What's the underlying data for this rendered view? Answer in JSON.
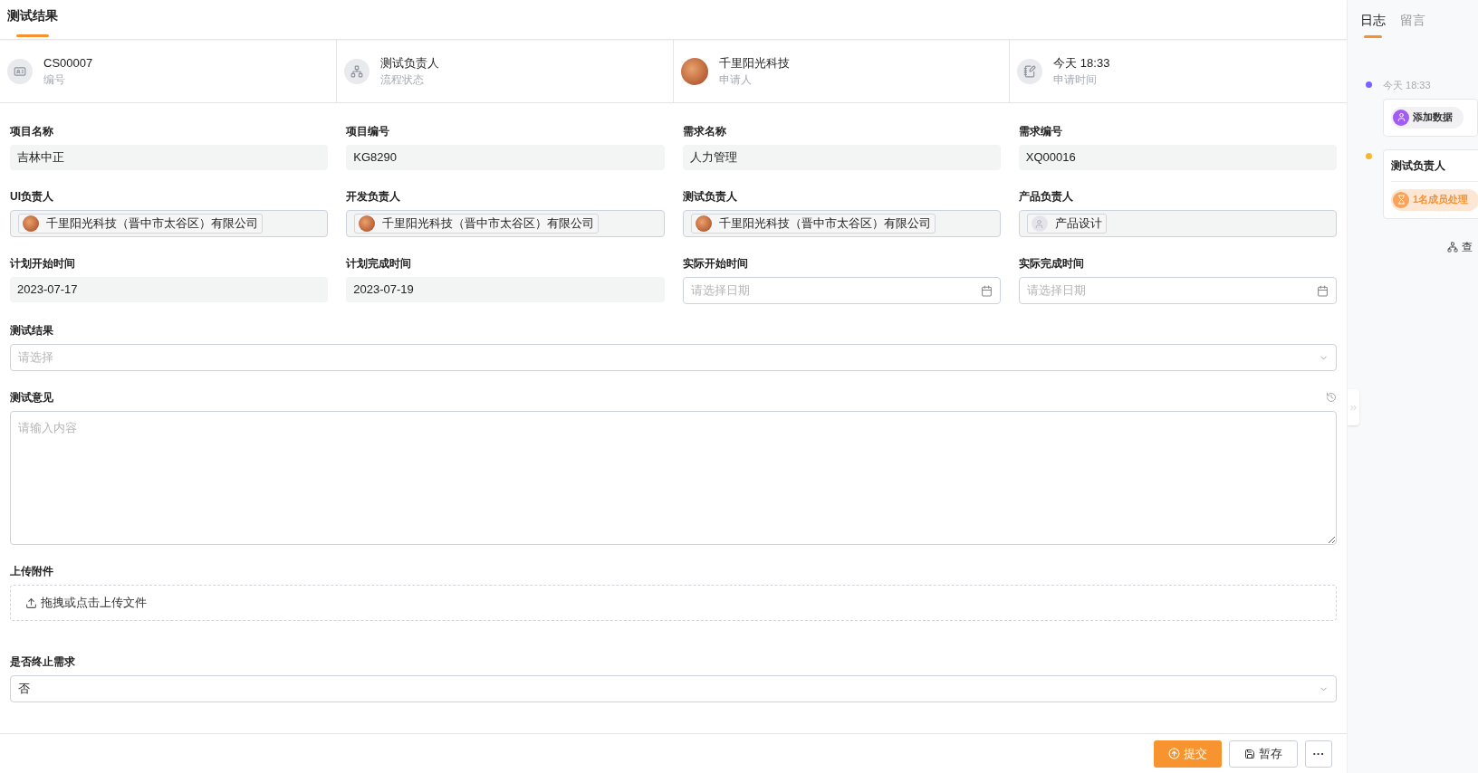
{
  "header_tabs": [
    {
      "label": "测试结果",
      "selected": true
    }
  ],
  "info_cards": [
    {
      "kind": "icon",
      "value": "CS00007",
      "label": "编号"
    },
    {
      "kind": "icon",
      "value": "测试负责人",
      "label": "流程状态"
    },
    {
      "kind": "photo",
      "value": "千里阳光科技",
      "label": "申请人"
    },
    {
      "kind": "icon",
      "value": "今天 18:33",
      "label": "申请时间"
    }
  ],
  "form_rows": [
    [
      {
        "kind": "readonly",
        "label": "项目名称",
        "value": "吉林中正"
      },
      {
        "kind": "readonly",
        "label": "项目编号",
        "value": "KG8290"
      },
      {
        "kind": "readonly",
        "label": "需求名称",
        "value": "人力管理"
      },
      {
        "kind": "readonly",
        "label": "需求编号",
        "value": "XQ00016"
      }
    ],
    [
      {
        "kind": "people",
        "label": "UI负责人",
        "chips": [
          {
            "kind": "photo",
            "name": "千里阳光科技（晋中市太谷区）有限公司"
          }
        ]
      },
      {
        "kind": "people",
        "label": "开发负责人",
        "chips": [
          {
            "kind": "photo",
            "name": "千里阳光科技（晋中市太谷区）有限公司"
          }
        ]
      },
      {
        "kind": "people",
        "label": "测试负责人",
        "chips": [
          {
            "kind": "photo",
            "name": "千里阳光科技（晋中市太谷区）有限公司"
          }
        ]
      },
      {
        "kind": "people",
        "label": "产品负责人",
        "chips": [
          {
            "kind": "default",
            "name": "产品设计"
          }
        ]
      }
    ],
    [
      {
        "kind": "readonly",
        "label": "计划开始时间",
        "value": "2023-07-17"
      },
      {
        "kind": "readonly",
        "label": "计划完成时间",
        "value": "2023-07-19"
      },
      {
        "kind": "date",
        "label": "实际开始时间",
        "placeholder": "请选择日期"
      },
      {
        "kind": "date",
        "label": "实际完成时间",
        "placeholder": "请选择日期"
      }
    ],
    [
      {
        "kind": "select",
        "label": "测试结果",
        "placeholder": "请选择"
      }
    ],
    [
      {
        "kind": "textarea",
        "label": "测试意见",
        "placeholder": "请输入内容"
      }
    ],
    [
      {
        "kind": "upload",
        "label": "上传附件",
        "text": "拖拽或点击上传文件"
      }
    ],
    [
      {
        "kind": "select",
        "label": "是否终止需求",
        "value": "否"
      }
    ]
  ],
  "footer_buttons": [
    {
      "kind": "primary",
      "label": "提交"
    },
    {
      "kind": "save",
      "label": "暂存"
    },
    {
      "kind": "more",
      "label": "···"
    }
  ],
  "side_tabs": [
    {
      "label": "日志",
      "selected": true
    },
    {
      "label": "留言",
      "selected": false
    }
  ],
  "timeline": [
    {
      "color": "#7b61ff",
      "time": "今天 18:33",
      "chip": {
        "kind": "action",
        "text": "添加数据"
      }
    },
    {
      "color": "#f5b82e",
      "title": "测试负责人",
      "chip": {
        "kind": "pending",
        "text": "1名成员处理"
      }
    }
  ],
  "side_link": "查"
}
